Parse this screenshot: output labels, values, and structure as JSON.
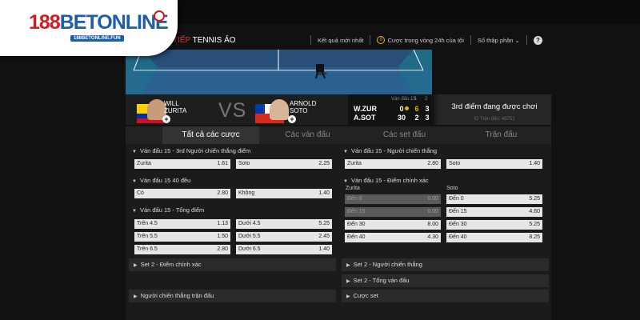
{
  "menu_fragment": "Q",
  "logo": {
    "num": "188",
    "word": "BETONLINE",
    "sub": "188BETONLINE.FUN"
  },
  "header": {
    "title_accent": "TIẾP",
    "title_rest": " TENNIS ẢO",
    "results_link": "Kết quả mới nhất",
    "matches_24h": "Cược trong vòng 24h của tôi",
    "matches_24h_icon_text": "0",
    "odds_format": "Số thập phân",
    "help": "?"
  },
  "match": {
    "home": {
      "line1": "WILL",
      "line2": "ZURITA"
    },
    "away": {
      "line1": "ARNOLD",
      "line2": "SOTO"
    },
    "vs": "VS",
    "score": {
      "label_game": "Ván đấu 15",
      "set1_label": "1",
      "set2_label": "2",
      "home_abbr": "W.ZUR",
      "away_abbr": "A.SOT",
      "home_points": "0",
      "away_points": "30",
      "home_set1": "6",
      "away_set1": "2",
      "home_set2": "3",
      "away_set2": "3",
      "accent_color": "#e8b100"
    },
    "status": "3rd điểm đang được chơi",
    "match_id": "ID Trận đấu: 48751"
  },
  "tabs": [
    "Tất cả các cược",
    "Các ván đấu",
    "Các set đấu",
    "Trận đấu"
  ],
  "left_sections": [
    {
      "title": "Ván đấu 15 - 3rd Người chiến thắng điểm",
      "rows": [
        [
          {
            "label": "Zurita",
            "odds": "1.61"
          },
          {
            "label": "Soto",
            "odds": "2.25"
          }
        ]
      ]
    },
    {
      "title": "Ván đấu 15 40 đều",
      "rows": [
        [
          {
            "label": "Có",
            "odds": "2.80"
          },
          {
            "label": "Không",
            "odds": "1.40"
          }
        ]
      ]
    },
    {
      "title": "Ván đấu 15 - Tổng điểm",
      "rows": [
        [
          {
            "label": "Trên 4.5",
            "odds": "1.13"
          },
          {
            "label": "Dưới 4.5",
            "odds": "5.25"
          }
        ],
        [
          {
            "label": "Trên 5.5",
            "odds": "1.50"
          },
          {
            "label": "Dưới 5.5",
            "odds": "2.45"
          }
        ],
        [
          {
            "label": "Trên 6.5",
            "odds": "2.80"
          },
          {
            "label": "Dưới 6.5",
            "odds": "1.40"
          }
        ]
      ]
    }
  ],
  "left_collapsed": [
    "Set 2 - Điểm chính xác",
    "Người chiến thắng trận đấu"
  ],
  "right_sections": [
    {
      "title": "Ván đấu 15 - Người chiến thắng",
      "rows": [
        [
          {
            "label": "Zurita",
            "odds": "2.80"
          },
          {
            "label": "Soto",
            "odds": "1.40"
          }
        ]
      ]
    },
    {
      "title": "Ván đấu 15 - Điểm chính xác",
      "col_left": "Zurita",
      "col_right": "Soto",
      "rows": [
        [
          {
            "label": "Đến 0",
            "odds": "0.00",
            "dim": true
          },
          {
            "label": "Đến 0",
            "odds": "5.25"
          }
        ],
        [
          {
            "label": "Đến 15",
            "odds": "0.00",
            "dim": true
          },
          {
            "label": "Đến 15",
            "odds": "4.60"
          }
        ],
        [
          {
            "label": "Đến 30",
            "odds": "8.00"
          },
          {
            "label": "Đến 30",
            "odds": "5.25"
          }
        ],
        [
          {
            "label": "Đến 40",
            "odds": "4.30"
          },
          {
            "label": "Đến 40",
            "odds": "8.25"
          }
        ]
      ]
    }
  ],
  "right_collapsed": [
    "Set 2 - Người chiến thắng",
    "Set 2 - Tổng ván đấu",
    "Cược set"
  ]
}
